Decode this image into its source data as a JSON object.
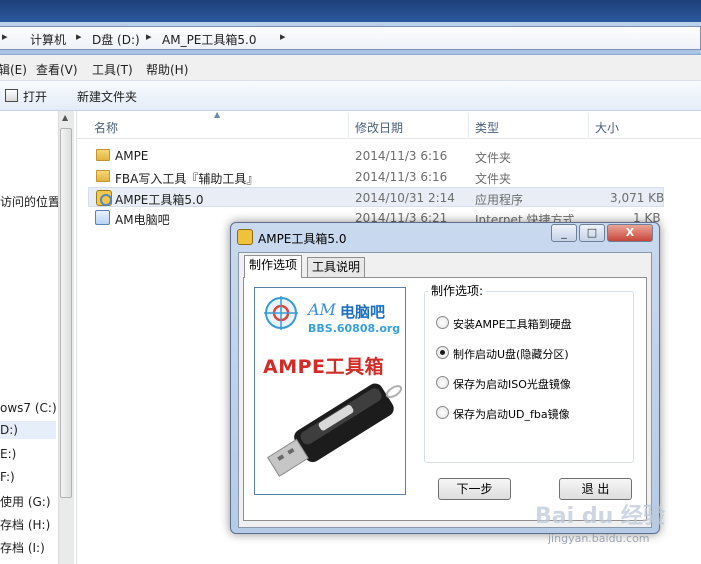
{
  "address": {
    "crumbs": [
      "计算机",
      "D盘 (D:)",
      "AM_PE工具箱5.0"
    ]
  },
  "menu": {
    "items": [
      "编辑(E)",
      "查看(V)",
      "工具(T)",
      "帮助(H)"
    ],
    "first_partial": "辑(E)"
  },
  "toolbar": {
    "open_label": "打开",
    "new_folder_label": "新建文件夹"
  },
  "nav": {
    "recent_partial": "访问的位置",
    "drives": [
      "ows7 (C:)",
      "D:)",
      "E:)",
      "F:)",
      "使用 (G:)",
      "存档 (H:)",
      "存档 (I:)"
    ],
    "selected_index": 1
  },
  "columns": {
    "name": "名称",
    "date": "修改日期",
    "type": "类型",
    "size": "大小"
  },
  "files": [
    {
      "name": "AMPE",
      "date": "2014/11/3 6:16",
      "type": "文件夹",
      "size": "",
      "icon": "folder-icon"
    },
    {
      "name": "FBA写入工具『辅助工具』",
      "date": "2014/11/3 6:16",
      "type": "文件夹",
      "size": "",
      "icon": "folder-icon"
    },
    {
      "name": "AMPE工具箱5.0",
      "date": "2014/10/31 2:14",
      "type": "应用程序",
      "size": "3,071 KB",
      "icon": "app-icon"
    },
    {
      "name": "AM电脑吧",
      "date": "2014/11/3 6:21",
      "type": "Internet 快捷方式",
      "size": "1 KB",
      "icon": "link-icon"
    }
  ],
  "dialog": {
    "title": "AMPE工具箱5.0",
    "minimize": "_",
    "maximize": "□",
    "close": "X",
    "tabs": [
      "制作选项",
      "工具说明"
    ],
    "brand_am": "AM",
    "brand_cn": "电脑吧",
    "brand_url": "BBS.60808.org",
    "brand_title": "AMPE工具箱",
    "options_legend": "制作选项:",
    "options": [
      {
        "label": "安装AMPE工具箱到硬盘",
        "selected": false
      },
      {
        "label": "制作启动U盘(隐藏分区)",
        "selected": true
      },
      {
        "label": "保存为启动ISO光盘镜像",
        "selected": false
      },
      {
        "label": "保存为启动UD_fba镜像",
        "selected": false
      }
    ],
    "next_label": "下一步",
    "exit_label": "退 出"
  },
  "watermark": {
    "text": "Bai du 经验",
    "sub": "jingyan.baidu.com"
  },
  "colors": {
    "accent_blue": "#3b8fd4",
    "brand_red": "#d22c28",
    "title_bar": "#1d3f7a"
  }
}
